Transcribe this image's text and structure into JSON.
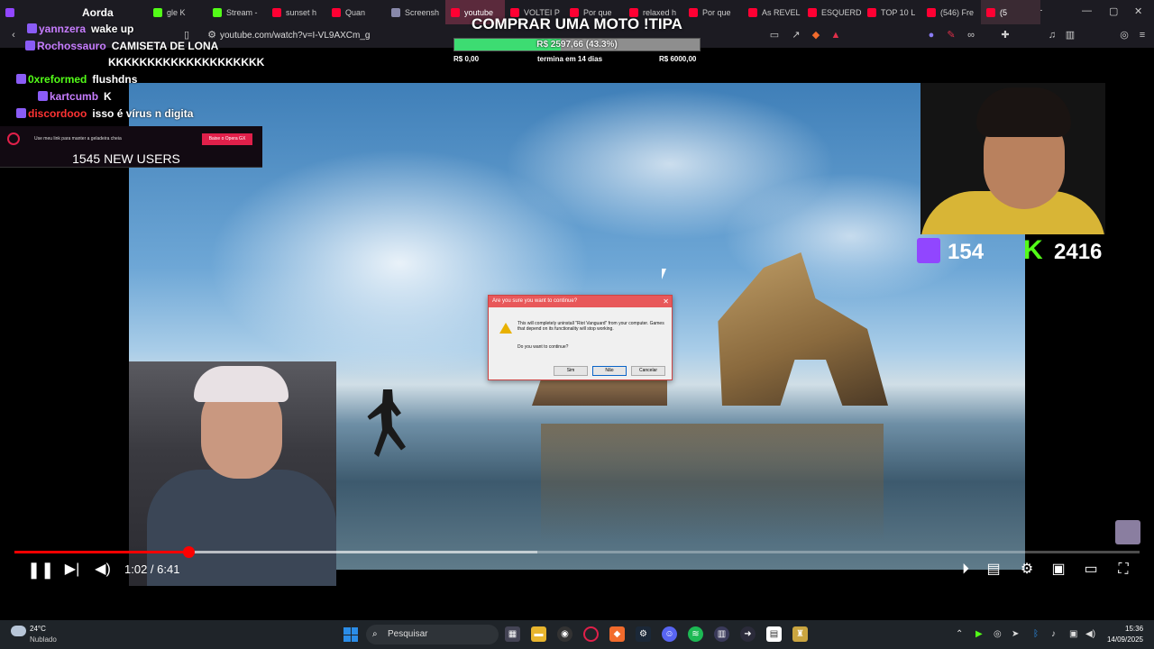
{
  "browser": {
    "tabs": [
      {
        "label": "Aorda",
        "color": "#9146ff"
      },
      {
        "label": "gle K",
        "color": "#53fc18"
      },
      {
        "label": "Stream -",
        "color": "#53fc18"
      },
      {
        "label": "sunset h",
        "color": "#ff0033"
      },
      {
        "label": "Quan",
        "color": "#ff0033"
      },
      {
        "label": "Screensh",
        "color": "#8888aa"
      },
      {
        "label": "youtube",
        "color": "#ff0033"
      },
      {
        "label": "VOLTEI P",
        "color": "#ff0033"
      },
      {
        "label": "Por que",
        "color": "#ff0033"
      },
      {
        "label": "relaxed h",
        "color": "#ff0033"
      },
      {
        "label": "Por que",
        "color": "#ff0033"
      },
      {
        "label": "As REVEL",
        "color": "#ff0033"
      },
      {
        "label": "ESQUERD",
        "color": "#ff0033"
      },
      {
        "label": "TOP 10 L",
        "color": "#ff0033"
      },
      {
        "label": "(546) Fre",
        "color": "#ff0033"
      },
      {
        "label": "(5",
        "color": "#ff0033"
      }
    ],
    "url": "youtube.com/watch?v=I-VL9AXCm_g"
  },
  "chat": [
    {
      "user": "yannzera",
      "msg": "wake up",
      "color": "#c77dff"
    },
    {
      "user": "Rochossauro",
      "msg": "CAMISETA DE LONA",
      "color": "#c77dff"
    },
    {
      "user": "",
      "msg": "KKKKKKKKKKKKKKKKKKKK",
      "color": "#ffffff"
    },
    {
      "user": "0xreformed",
      "msg": "flushdns",
      "color": "#53fc18"
    },
    {
      "user": "kartcumb",
      "msg": "K",
      "color": "#c77dff"
    },
    {
      "user": "discordooo",
      "msg": "isso é vírus n digita",
      "color": "#ff3333"
    }
  ],
  "goal": {
    "title": "COMPRAR UMA MOTO !TIPA",
    "amount": "R$ 2597,66 (43.3%)",
    "percent": 43.3,
    "min": "R$ 0,00",
    "remaining": "termina em 14 dias",
    "max": "R$ 6000,00"
  },
  "promo": {
    "text": "Use meu link para manter a geladeira cheia",
    "button": "Baixe o Opera GX",
    "users": "1545 NEW USERS"
  },
  "viewers": {
    "twitch": "154",
    "kick": "2416"
  },
  "dialog": {
    "title": "Are you sure you want to continue?",
    "message": "This will completely uninstall \"Riot Vanguard\" from your computer. Games that depend on its functionality will stop working.",
    "question": "Do you want to continue?",
    "buttons": [
      "Sim",
      "Não",
      "Cancelar"
    ]
  },
  "player": {
    "time": "1:02 / 6:41",
    "progress_fraction": 0.155
  },
  "taskbar": {
    "temp": "24°C",
    "weather": "Nublado",
    "search": "Pesquisar",
    "time": "15:36",
    "date": "14/09/2025"
  }
}
